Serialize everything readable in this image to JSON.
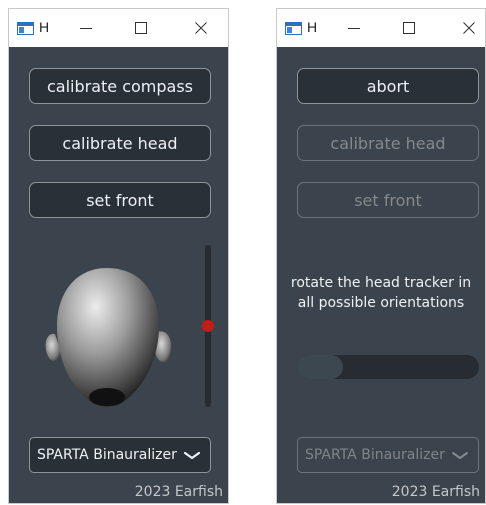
{
  "windows": [
    {
      "title": "H",
      "buttons": {
        "calibrate_compass": "calibrate compass",
        "calibrate_head": "calibrate head",
        "set_front": "set front"
      },
      "selector": {
        "value": "SPARTA Binauralizer"
      },
      "slider": {
        "value": 0.5
      },
      "footer": "2023 Earfish"
    },
    {
      "title": "H",
      "buttons": {
        "abort": "abort",
        "calibrate_head": "calibrate head",
        "set_front": "set front"
      },
      "instruction": "rotate the head tracker in all possible orientations",
      "progress": {
        "value": 0.25
      },
      "selector": {
        "value": "SPARTA Binauralizer"
      },
      "footer": "2023 Earfish"
    }
  ],
  "icons": {
    "app": "app-window-icon",
    "minimize": "minimize-icon",
    "maximize": "maximize-icon",
    "close": "close-icon",
    "dropdown": "chevron-down-icon"
  },
  "colors": {
    "panel": "#3b444c",
    "button": "#293036",
    "border": "#8d959c",
    "slider_thumb": "#c51b17",
    "text": "#eef1f3"
  }
}
